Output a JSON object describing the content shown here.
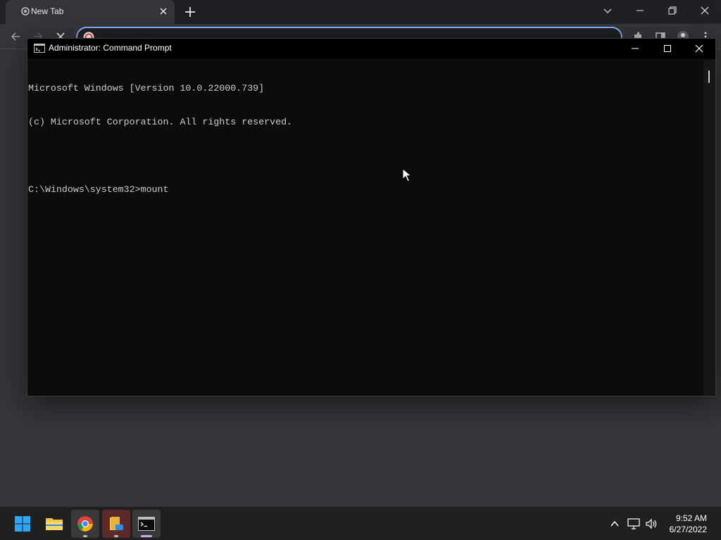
{
  "browser": {
    "tab_title": "New Tab",
    "omnibox_value": ""
  },
  "cmd": {
    "window_title": "Administrator: Command Prompt",
    "lines": [
      "Microsoft Windows [Version 10.0.22000.739]",
      "(c) Microsoft Corporation. All rights reserved.",
      "",
      "C:\\Windows\\system32>mount"
    ]
  },
  "taskbar": {
    "apps": [
      "windows-start",
      "file-explorer",
      "google-chrome",
      "file-manager",
      "command-prompt"
    ],
    "time": "9:52 AM",
    "date": "6/27/2022"
  },
  "colors": {
    "accent": "#8ab4f8",
    "console_bg": "#0c0c0c",
    "console_text": "#cccccc",
    "taskbar_bg": "#202020"
  }
}
